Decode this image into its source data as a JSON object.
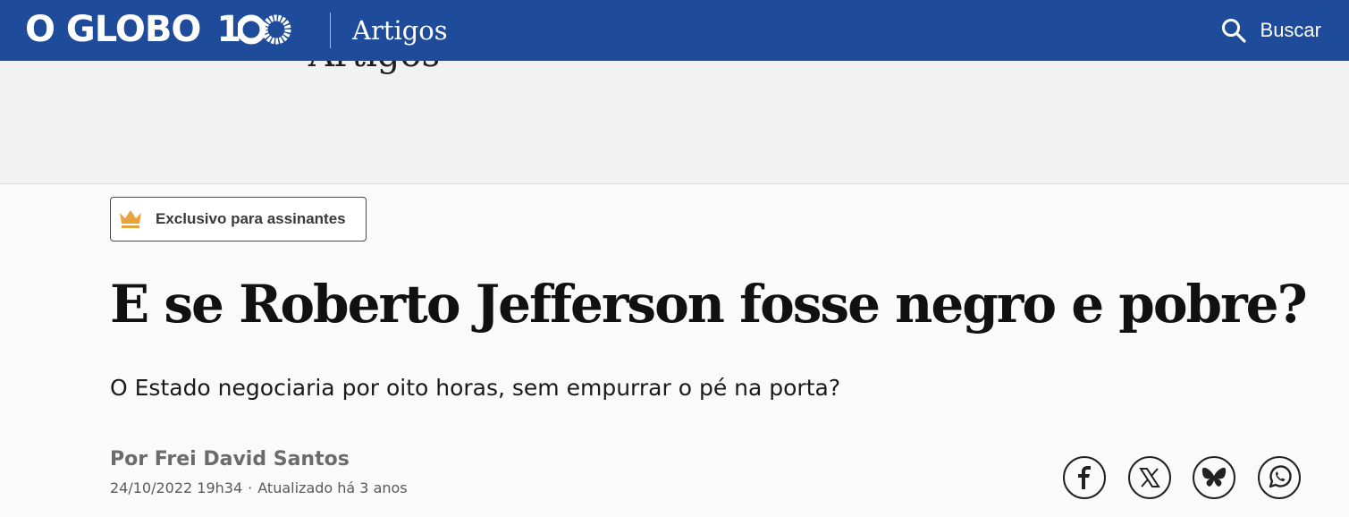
{
  "header": {
    "logo_text": "O GLOBO",
    "logo_anniversary": "100",
    "section": "Artigos",
    "search_label": "Buscar"
  },
  "banner": {
    "ghost_text": "Artigos"
  },
  "article": {
    "badge": "Exclusivo para assinantes",
    "headline": "E se Roberto Jefferson fosse negro e pobre?",
    "subtitle": "O Estado negociaria por oito horas, sem empurrar o pé na porta?",
    "byline": "Por Frei David Santos",
    "published": "24/10/2022 19h34",
    "separator": "·",
    "updated": "Atualizado há 3 anos"
  },
  "share": {
    "icons": [
      "facebook-icon",
      "x-icon",
      "bluesky-icon",
      "whatsapp-icon"
    ]
  },
  "colors": {
    "header_bg": "#1e4b9a",
    "crown": "#e8a33d",
    "banner_bg": "#f2f2f2"
  }
}
